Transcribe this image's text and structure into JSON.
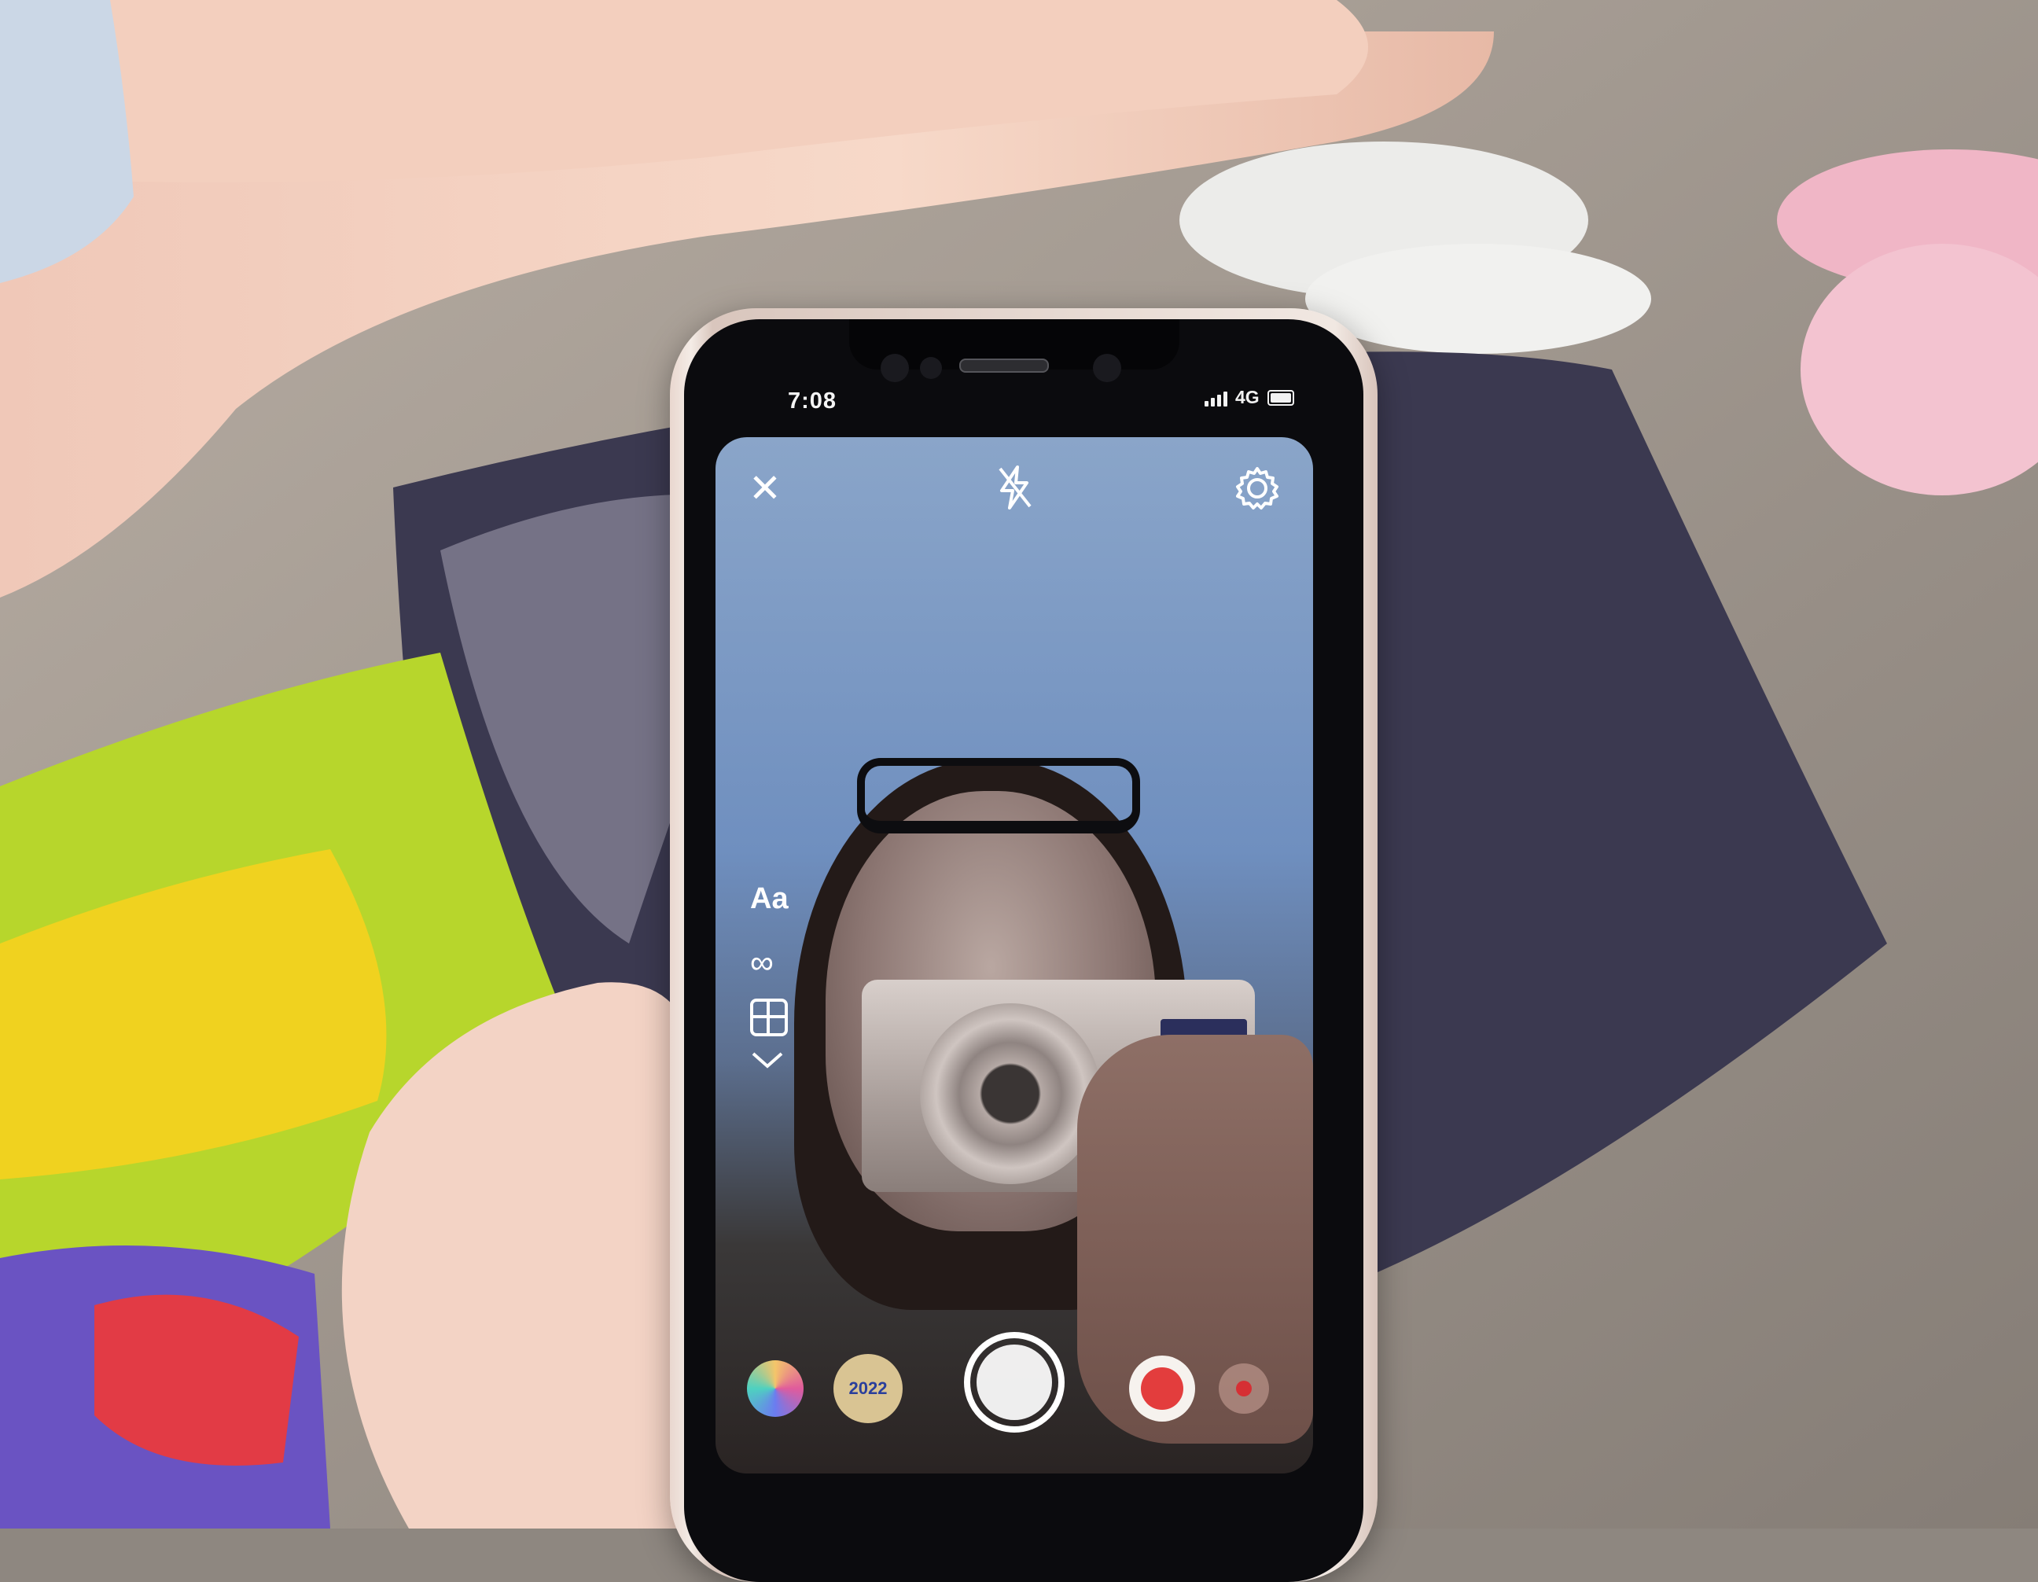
{
  "status_bar": {
    "time": "7:08",
    "network": "4G"
  },
  "camera": {
    "top_icons": [
      "close-icon",
      "flash-off-icon",
      "gear-icon"
    ],
    "side_tools": {
      "text_tool_label": "Aa",
      "boomerang_icon": "infinity-icon",
      "layout_icon": "layout-grid-icon",
      "more_icon": "chevron-down-icon"
    },
    "effects": [
      {
        "name": "rainbow-effect"
      },
      {
        "name": "2022-effect",
        "label": "2022"
      },
      {
        "name": "sticker-effect"
      },
      {
        "name": "dot-effect"
      }
    ]
  },
  "colors": {
    "icon": "#ffffff",
    "sticker_red": "#e33d3d",
    "badge_blue": "#2a3f9c"
  }
}
